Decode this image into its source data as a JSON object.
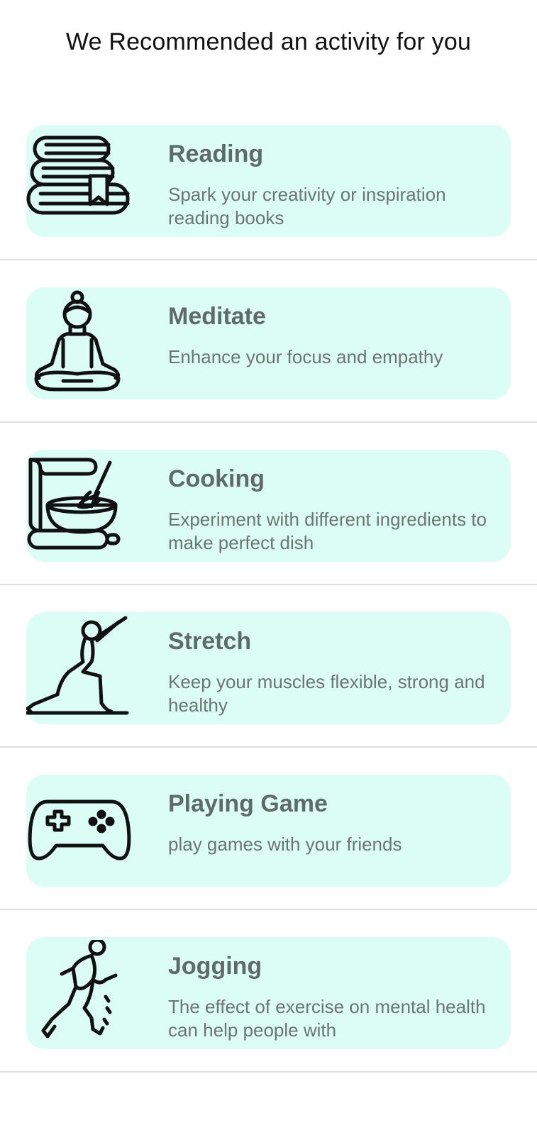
{
  "header": {
    "title": "We Recommended an activity for you"
  },
  "activities": [
    {
      "title": "Reading",
      "description": "Spark your creativity or inspiration reading books",
      "icon": "books-icon"
    },
    {
      "title": "Meditate",
      "description": "Enhance your focus and empathy",
      "icon": "meditation-icon"
    },
    {
      "title": "Cooking",
      "description": "Experiment with different ingredients to make perfect dish",
      "icon": "cooking-icon"
    },
    {
      "title": "Stretch",
      "description": "Keep your muscles flexible, strong and healthy",
      "icon": "stretch-icon"
    },
    {
      "title": "Playing Game",
      "description": "play games with your friends",
      "icon": "gamepad-icon"
    },
    {
      "title": "Jogging",
      "description": "The effect of exercise on mental health can help people with",
      "icon": "jogging-icon"
    }
  ],
  "colors": {
    "card_background": "#dcfcf6",
    "title_text": "#5f6b67",
    "description_text": "#6b7572",
    "divider": "#dedede"
  }
}
